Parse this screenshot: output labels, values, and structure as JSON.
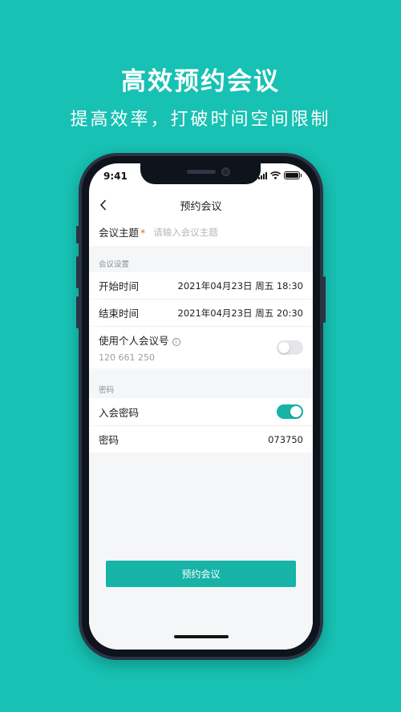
{
  "hero": {
    "title": "高效预约会议",
    "subtitle": "提高效率，打破时间空间限制"
  },
  "status_bar": {
    "time": "9:41",
    "icons": [
      "signal-icon",
      "wifi-icon",
      "battery-icon"
    ]
  },
  "nav": {
    "back_icon": "chevron-left-icon",
    "title": "预约会议"
  },
  "topic": {
    "label": "会议主题",
    "required_mark": "*",
    "placeholder": "请输入会议主题",
    "value": ""
  },
  "meeting_settings": {
    "section_label": "会议设置",
    "start": {
      "label": "开始时间",
      "value": "2021年04月23日 周五 18:30"
    },
    "end": {
      "label": "结束时间",
      "value": "2021年04月23日 周五 20:30"
    },
    "personal_id": {
      "label": "使用个人会议号",
      "info_icon": "info-icon",
      "number": "120 661 250",
      "enabled": false
    }
  },
  "password_section": {
    "section_label": "密码",
    "join_password": {
      "label": "入会密码",
      "enabled": true
    },
    "password": {
      "label": "密码",
      "value": "073750"
    }
  },
  "actions": {
    "book_label": "预约会议"
  },
  "colors": {
    "background": "#17c1b3",
    "accent": "#16b3a6",
    "required": "#e8642c"
  }
}
